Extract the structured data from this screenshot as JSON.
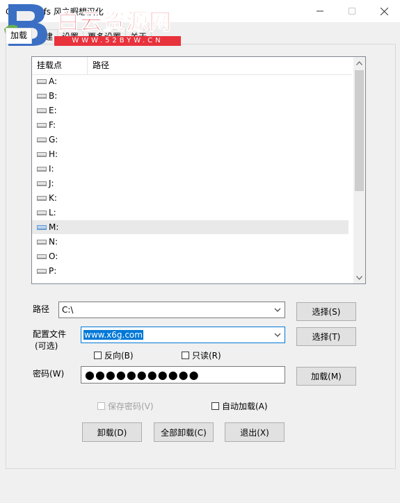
{
  "window": {
    "title": "Cppcryptfs 风之暇想汉化"
  },
  "watermark": {
    "logo_letter": "B",
    "text": "白云资源网",
    "url": "WWW.52BYW.CN"
  },
  "tabs": [
    {
      "label": "加载",
      "active": true
    },
    {
      "label": "创建",
      "active": false
    },
    {
      "label": "设置",
      "active": false
    },
    {
      "label": "更多设置",
      "active": false
    },
    {
      "label": "关于",
      "active": false
    }
  ],
  "drive_list": {
    "columns": [
      "挂载点",
      "路径"
    ],
    "rows": [
      {
        "drive": "A:",
        "path": ""
      },
      {
        "drive": "B:",
        "path": ""
      },
      {
        "drive": "E:",
        "path": ""
      },
      {
        "drive": "F:",
        "path": ""
      },
      {
        "drive": "G:",
        "path": ""
      },
      {
        "drive": "H:",
        "path": ""
      },
      {
        "drive": "I:",
        "path": ""
      },
      {
        "drive": "J:",
        "path": ""
      },
      {
        "drive": "K:",
        "path": ""
      },
      {
        "drive": "L:",
        "path": ""
      },
      {
        "drive": "M:",
        "path": "",
        "selected": true
      },
      {
        "drive": "N:",
        "path": ""
      },
      {
        "drive": "O:",
        "path": ""
      },
      {
        "drive": "P:",
        "path": ""
      }
    ]
  },
  "form": {
    "path_label": "路径",
    "path_value": "C:\\",
    "path_select_button": "选择(S)",
    "config_label_line1": "配置文件",
    "config_label_line2": "(可选)",
    "config_value": "www.x6g.com",
    "config_select_button": "选择(T)",
    "reverse_label": "反向(B)",
    "readonly_label": "只读(R)",
    "password_label": "密码(W)",
    "password_value": "●●●●●●●●●●●",
    "mount_button": "加载(M)",
    "save_password_label": "保存密码(V)",
    "auto_mount_label": "自动加载(A)"
  },
  "actions": {
    "unmount": "卸载(D)",
    "unmount_all": "全部卸载(C)",
    "exit": "退出(X)"
  },
  "colors": {
    "accent": "#0078d7",
    "watermark_red": "#e8323c",
    "window_bg": "#f0f0f0"
  }
}
